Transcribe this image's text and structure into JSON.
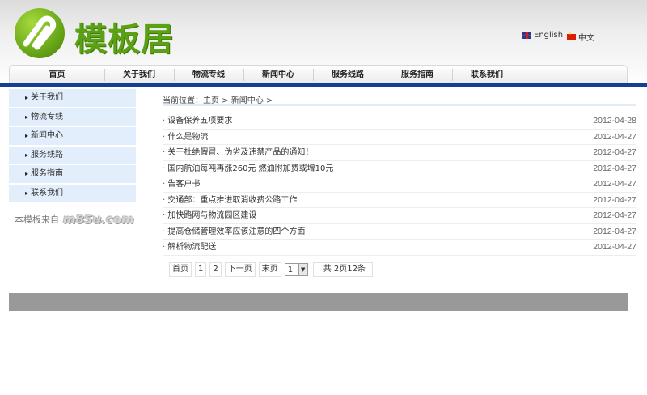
{
  "site": {
    "logo_text": "模板居"
  },
  "lang": {
    "english": "English",
    "chinese": "中文"
  },
  "nav": [
    "首页",
    "关于我们",
    "物流专线",
    "新闻中心",
    "服务线路",
    "服务指南",
    "联系我们"
  ],
  "sidebar": [
    "关于我们",
    "物流专线",
    "新闻中心",
    "服务线路",
    "服务指南",
    "联系我们"
  ],
  "credit": {
    "text": "本模板来自",
    "logo": "m85u.com"
  },
  "breadcrumb": "当前位置：主页 > 新闻中心 >",
  "news": [
    {
      "title": "设备保养五项要求",
      "date": "2012-04-28"
    },
    {
      "title": "什么是物流",
      "date": "2012-04-27"
    },
    {
      "title": "关于杜绝假冒、伪劣及违禁产品的通知！",
      "date": "2012-04-27"
    },
    {
      "title": "国内航油每吨再涨260元 燃油附加费或增10元",
      "date": "2012-04-27"
    },
    {
      "title": "告客户书",
      "date": "2012-04-27"
    },
    {
      "title": "交通部：重点推进取消收费公路工作",
      "date": "2012-04-27"
    },
    {
      "title": "加快路网与物流园区建设",
      "date": "2012-04-27"
    },
    {
      "title": "提高仓储管理效率应该注意的四个方面",
      "date": "2012-04-27"
    },
    {
      "title": "解析物流配送",
      "date": "2012-04-27"
    }
  ],
  "pager": {
    "first": "首页",
    "page1": "1",
    "page2": "2",
    "next": "下一页",
    "last": "末页",
    "select_value": "1",
    "total": "共 2页12条"
  },
  "colors": {
    "nav_bar": "#153e95",
    "sidebar_bg": "#e2eefb",
    "logo_green": "#5aa214",
    "footer": "#999999"
  }
}
